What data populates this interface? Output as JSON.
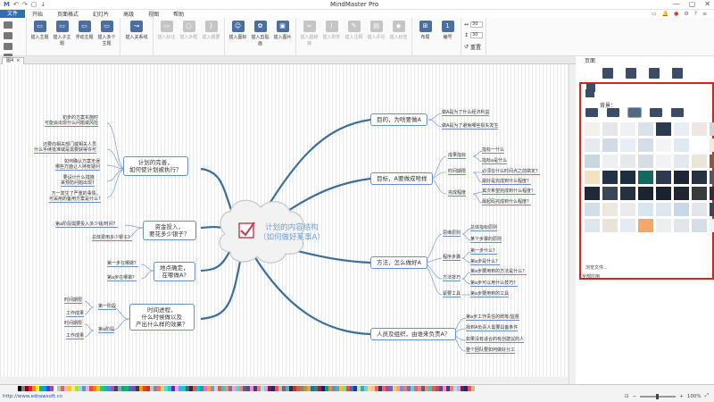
{
  "titlebar": {
    "title": "MindMaster Pro",
    "qat_icons": [
      "M",
      "↶",
      "↷",
      "▢",
      "↓"
    ],
    "window_buttons": [
      "—",
      "▢",
      "✕"
    ]
  },
  "menu": {
    "items": [
      "文件",
      "开始",
      "页面格式",
      "幻灯片",
      "高级",
      "视图",
      "帮助"
    ],
    "right_items": [
      "▭",
      "🔔",
      "●",
      "⚙",
      "?",
      "≡"
    ]
  },
  "ribbon": {
    "groups": [
      {
        "buttons": [
          "插入主题",
          "插入子主题",
          "浮动主题",
          "插入多个主题"
        ]
      },
      {
        "buttons": [
          "插入关系线"
        ]
      },
      {
        "buttons": [
          "插入标注",
          "插入外框",
          "插入概要"
        ]
      },
      {
        "buttons": [
          "插入图标",
          "插入剪贴画",
          "插入图片"
        ]
      },
      {
        "buttons": [
          "插入超链接",
          "插入附件",
          "插入注释",
          "插入评论",
          "插入标签"
        ]
      },
      {
        "buttons": [
          "布局",
          "编号"
        ]
      }
    ],
    "spin1": "30",
    "spin2": "30",
    "reset_label": "重置"
  },
  "tab": {
    "label": "图4"
  },
  "mindmap": {
    "center": [
      "计划的内容结构",
      "（如何做好某事A）"
    ],
    "left_main": [
      [
        "计划的完善，",
        "如何使计划被执行？"
      ],
      [
        "资金投入，",
        "要花多少银子？"
      ],
      [
        "地点确定，",
        "在哪做A?"
      ],
      [
        "时间进程，",
        "什么时候做以及",
        "产出什么样的效果？"
      ]
    ],
    "left_leaves_1": [
      "初步的方案实施时",
      "可能会出现什么问题或风险",
      "还要向相关部门或相关人员",
      "什么手续批准或是需要获得许可",
      "如何确认方案无误",
      "哪些方面让人持有疑问",
      "要设计什么措施",
      "来预防问题出现?",
      "万一发生了严重的事情，",
      "可采用的备用方案是什么?"
    ],
    "left_leaves_2": [
      "第a阶段需要投入多少钱/时间？",
      "总体费用多少银子？"
    ],
    "left_leaves_3": [
      "第一步在哪做？",
      "第a步在哪做？"
    ],
    "left_leaves_4": [
      "时间期限",
      "第一阶段",
      "工作成果",
      "时间期限",
      "第a阶段",
      "工作成果"
    ],
    "right_main": [
      "目的，为啥要做A",
      "目标，A要做成啥样",
      "方法，怎么做好A",
      "人员及组织，由谁来负责A？"
    ],
    "right_leaves_1": [
      "做A是为了什么经济利益",
      "做A是为了避免哪些损失发生"
    ],
    "right_mid_2": [
      "成果指标",
      "时间期限",
      "完成程度"
    ],
    "right_leaves_2": [
      "指标一什么",
      "指标a是什么",
      "必须在什么时间点之前搞定？",
      "最好是完成到什么程度？",
      "其次希望完成到什么程度？",
      "最起码完成到什么程度？"
    ],
    "right_mid_3": [
      "思维原则",
      "程序步骤",
      "方法技巧",
      "紧要工具"
    ],
    "right_leaves_3": [
      "总体指标原则",
      "某个步骤的原则",
      "第一步什么？",
      "第a步是什么？",
      "第a步要用到的方法是什么？",
      "第a步可以用什么技巧？",
      "第a步要用到的工具"
    ],
    "right_leaves_4": [
      "第a步工作责任的统筹/监督",
      "找到A负责人需要具备条件",
      "如果没有适合的有创建议的人",
      "整个团队要如何做好分工"
    ]
  },
  "panel": {
    "title": "页面",
    "bg_label": "背景：",
    "path_label": "浏览文件...",
    "extra_label": "全部应用"
  },
  "swatches": [
    "#f3f1ec",
    "#e5e7ea",
    "#eef2f4",
    "#d9e3ea",
    "#2c3a52",
    "#e8eef3",
    "#f0e6e4",
    "#d1d4d8",
    "#e6ebef",
    "#cfdbe6",
    "#e8eef6",
    "#d5dde6",
    "#f4f4f4",
    "#dfe9f1",
    "#ffffff",
    "#f5e9d9",
    "#c9d7e3",
    "#eef0f2",
    "#e6e9eb",
    "#d7dde3",
    "#f1f3f5",
    "#e3e9ef",
    "#ece6da",
    "#8c5a3a",
    "#f3e2bf",
    "#243247",
    "#1c2f3e",
    "#12695e",
    "#2d3a52",
    "#1e2433",
    "#273142",
    "#56575a",
    "#1f2937",
    "#3d4657",
    "#26303e",
    "#1c2430",
    "#1a2230",
    "#20252f",
    "#3a3a3a",
    "#2b2f36",
    "#d3dfe8",
    "#ede9e1",
    "#ece9f0",
    "#d8e6f0",
    "#dfe7ee",
    "#c9d8e6",
    "#e3e5e8",
    "#3c4657",
    "#dfe6ee",
    "#e9e4da",
    "#e4ecf3",
    "#f2a76d",
    "#eceef0",
    "#e0e6ec",
    "#d5dde5",
    "#f0f2f4"
  ],
  "status": {
    "url": "http://www.edrawsoft.cn",
    "zoom": "100%"
  },
  "palette": [
    "#000000",
    "#7f7f7f",
    "#880015",
    "#ed1c24",
    "#ff7f27",
    "#fff200",
    "#22b14c",
    "#00a2e8",
    "#3f48cc",
    "#a349a4",
    "#ffffff",
    "#c3c3c3",
    "#b97a57",
    "#ffaec9",
    "#ffc90e",
    "#efe4b0",
    "#b5e61d",
    "#99d9ea",
    "#7092be",
    "#c8bfe7",
    "#e74c3c",
    "#e67e22",
    "#f1c40f",
    "#2ecc71",
    "#1abc9c",
    "#3498db",
    "#9b59b6",
    "#34495e",
    "#95a5a6",
    "#16a085",
    "#27ae60",
    "#2980b9",
    "#8e44ad",
    "#2c3e50",
    "#f39c12",
    "#d35400",
    "#c0392b",
    "#bdc3c7",
    "#7f8c8d",
    "#ff6b6b",
    "#feca57",
    "#48dbfb",
    "#1dd1a1",
    "#5f27cd",
    "#ff9ff3",
    "#54a0ff",
    "#00d2d3",
    "#576574",
    "#222f3e",
    "#ee5253",
    "#0abde3",
    "#10ac84",
    "#f368e0",
    "#ff9f43",
    "#8395a7",
    "#c8d6e5",
    "#e15f41",
    "#3dc1d3",
    "#f19066",
    "#786fa6",
    "#f8a5c2",
    "#63cdda",
    "#ea8685",
    "#596275",
    "#574b90",
    "#f78fb3",
    "#3b3b98",
    "#fd7272",
    "#9aecdb",
    "#d6a2e8",
    "#6d214f",
    "#182c61",
    "#fc427b",
    "#bdc581",
    "#82589f",
    "#58b19f",
    "#2c2c54",
    "#b33939",
    "#cd6133",
    "#84817a",
    "#cc8e35",
    "#ccae62",
    "#227093",
    "#218c74",
    "#b71540",
    "#0c2461",
    "#079992",
    "#e58e26",
    "#6a89cc",
    "#60a3bc",
    "#f6b93b",
    "#78e08f",
    "#e55039",
    "#4a69bd",
    "#1e3799",
    "#b8e994",
    "#38ada9",
    "#82ccdd",
    "#fad390",
    "#f8c291",
    "#e66767",
    "#303952",
    "#cf6a87",
    "#c44569",
    "#546de5",
    "#f5cd79",
    "#f3a683",
    "#778beb",
    "#e77f67",
    "#786fa6",
    "#63cdda",
    "#cf6a87",
    "#ea8685",
    "#596275",
    "#f19066",
    "#3dc1d3",
    "#e15f41",
    "#c44569",
    "#574b90",
    "#f78fb3",
    "#3b3b98",
    "#fd7272",
    "#9aecdb",
    "#d6a2e8",
    "#6d214f",
    "#182c61",
    "#fc427b",
    "#bdc581"
  ]
}
